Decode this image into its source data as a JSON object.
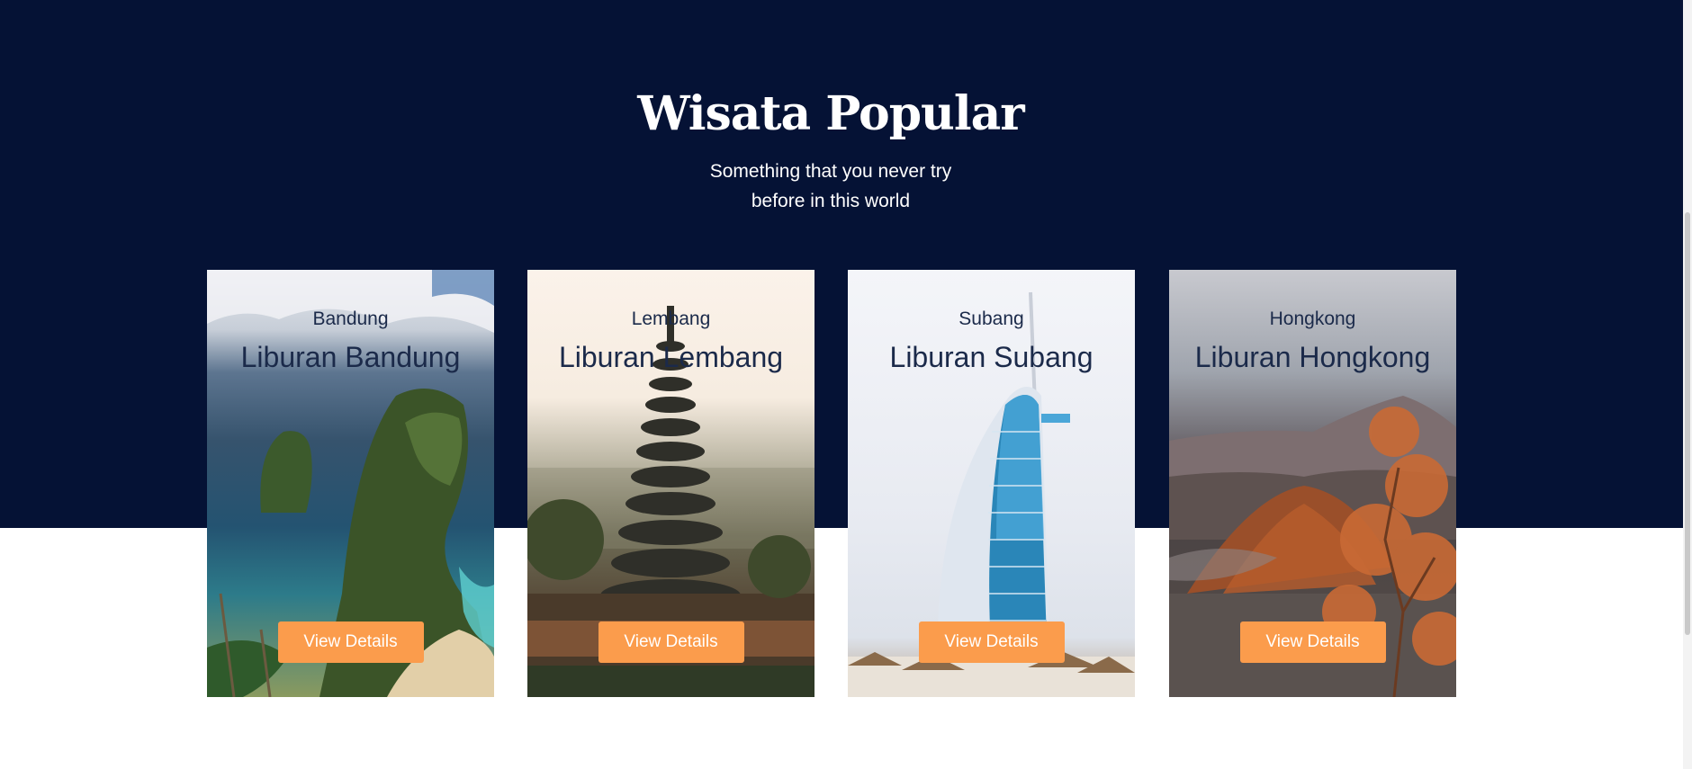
{
  "section": {
    "title": "Wisata Popular",
    "subtitle_line1": "Something that you never try",
    "subtitle_line2": "before in this world"
  },
  "cards": [
    {
      "location": "Bandung",
      "title": "Liburan Bandung",
      "button": "View Details"
    },
    {
      "location": "Lembang",
      "title": "Liburan Lembang",
      "button": "View Details"
    },
    {
      "location": "Subang",
      "title": "Liburan Subang",
      "button": "View Details"
    },
    {
      "location": "Hongkong",
      "title": "Liburan Hongkong",
      "button": "View Details"
    }
  ],
  "colors": {
    "hero_background": "#051235",
    "button": "#fb9c4c",
    "card_text": "#1b2a4a"
  }
}
